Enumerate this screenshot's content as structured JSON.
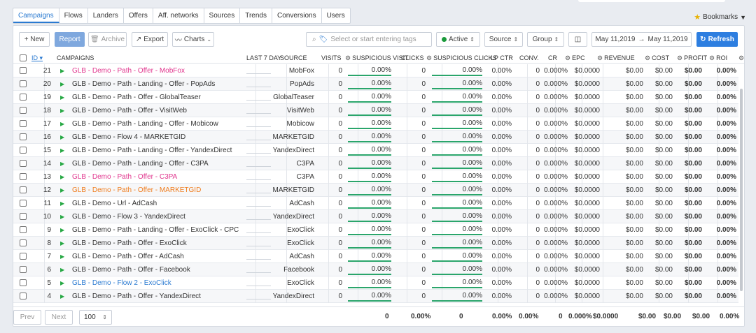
{
  "nav": {
    "tabs": [
      "Campaigns",
      "Flows",
      "Landers",
      "Offers",
      "Aff. networks",
      "Sources",
      "Trends",
      "Conversions",
      "Users"
    ],
    "active": "Campaigns",
    "bookmarks_label": "Bookmarks"
  },
  "toolbar": {
    "new_label": "+ New",
    "report_label": "Report",
    "archive_label": "Archive",
    "export_label": "Export",
    "charts_label": "Charts",
    "search_placeholder": "Select or start entering tags",
    "status_label": "Active",
    "source_label": "Source",
    "group_label": "Group",
    "date_from": "May 11,2019",
    "date_to": "May 11,2019",
    "date_arrow": "→",
    "refresh_label": "Refresh"
  },
  "columns": {
    "id": "ID",
    "campaigns": "CAMPAIGNS",
    "last7": "LAST 7 DAY",
    "source": "SOURCE",
    "visits": "VISITS",
    "susp_visit": "SUSPICIOUS VISIT",
    "clicks": "CLICKS",
    "susp_clicks": "SUSPICIOUS CLICKS",
    "lp_ctr": "LP CTR",
    "conv": "CONV.",
    "cr": "CR",
    "epc": "EPC",
    "revenue": "REVENUE",
    "cost": "COST",
    "profit": "PROFIT",
    "roi": "ROI"
  },
  "colors": {
    "pink": "#e0338c",
    "orange": "#ef7d1f",
    "blue": "#2a7ad1",
    "default": "#333333",
    "play": "#27a844",
    "bar": "#2aa56b"
  },
  "rows": [
    {
      "id": "21",
      "name": "GLB - Demo - Path - Offer - MobFox",
      "source": "MobFox",
      "color": "pink"
    },
    {
      "id": "20",
      "name": "GLB - Demo - Path - Landing - Offer - PopAds",
      "source": "PopAds",
      "color": "default"
    },
    {
      "id": "19",
      "name": "GLB - Demo - Path - Offer - GlobalTeaser",
      "source": "GlobalTeaser",
      "color": "default"
    },
    {
      "id": "18",
      "name": "GLB - Demo - Path - Offer - VisitWeb",
      "source": "VisitWeb",
      "color": "default"
    },
    {
      "id": "17",
      "name": "GLB - Demo - Path - Landing - Offer - Mobicow",
      "source": "Mobicow",
      "color": "default"
    },
    {
      "id": "16",
      "name": "GLB - Demo - Flow 4 - MARKETGID",
      "source": "MARKETGID",
      "color": "default"
    },
    {
      "id": "15",
      "name": "GLB - Demo - Path - Landing - Offer - YandexDirect",
      "source": "YandexDirect",
      "color": "default"
    },
    {
      "id": "14",
      "name": "GLB - Demo - Path - Landing - Offer - C3PA",
      "source": "C3PA",
      "color": "default"
    },
    {
      "id": "13",
      "name": "GLB - Demo - Path - Offer - C3PA",
      "source": "C3PA",
      "color": "pink"
    },
    {
      "id": "12",
      "name": "GLB - Demo - Path - Offer - MARKETGID",
      "source": "MARKETGID",
      "color": "orange"
    },
    {
      "id": "11",
      "name": "GLB - Demo - Url - AdCash",
      "source": "AdCash",
      "color": "default"
    },
    {
      "id": "10",
      "name": "GLB - Demo - Flow 3 - YandexDirect",
      "source": "YandexDirect",
      "color": "default"
    },
    {
      "id": "9",
      "name": "GLB - Demo - Path - Landing - Offer - ExoClick - CPC",
      "source": "ExoClick",
      "color": "default"
    },
    {
      "id": "8",
      "name": "GLB - Demo - Path - Offer - ExoClick",
      "source": "ExoClick",
      "color": "default"
    },
    {
      "id": "7",
      "name": "GLB - Demo - Path - Offer - AdCash",
      "source": "AdCash",
      "color": "default"
    },
    {
      "id": "6",
      "name": "GLB - Demo - Path - Offer - Facebook",
      "source": "Facebook",
      "color": "default"
    },
    {
      "id": "5",
      "name": "GLB - Demo - Flow 2 - ExoClick",
      "source": "ExoClick",
      "color": "blue"
    },
    {
      "id": "4",
      "name": "GLB - Demo - Path - Offer - YandexDirect",
      "source": "YandexDirect",
      "color": "default"
    }
  ],
  "row_values": {
    "visits": "0",
    "susp_visit": "0.00%",
    "clicks": "0",
    "susp_clicks": "0.00%",
    "lp_ctr": "0.00%",
    "conv": "0",
    "cr": "0.000%",
    "epc": "$0.0000",
    "revenue": "$0.00",
    "cost": "$0.00",
    "profit": "$0.00",
    "roi": "0.00%"
  },
  "footer": {
    "prev_label": "Prev",
    "next_label": "Next",
    "page_size": "100",
    "totals": {
      "visits": "0",
      "susp_visit": "0.00%",
      "clicks": "0",
      "lp_ctr": "0.00%",
      "conv_rate": "0.00%",
      "conv": "0",
      "cr": "0.000%",
      "epc": "$0.0000",
      "revenue": "$0.00",
      "cost": "$0.00",
      "profit": "$0.00",
      "roi": "0.00%"
    }
  }
}
